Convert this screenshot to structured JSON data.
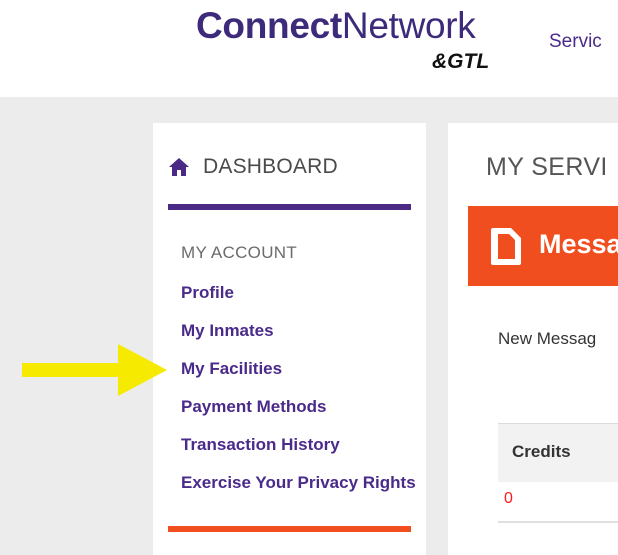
{
  "header": {
    "logo": {
      "primary": "Connect",
      "secondary": "Network",
      "sub": "&GTL"
    },
    "nav": [
      {
        "label": "Servic"
      }
    ]
  },
  "sidebar": {
    "dashboard_label": "DASHBOARD",
    "section_heading": "MY ACCOUNT",
    "items": [
      {
        "label": "Profile"
      },
      {
        "label": "My Inmates"
      },
      {
        "label": "My Facilities"
      },
      {
        "label": "Payment Methods"
      },
      {
        "label": "Transaction History"
      },
      {
        "label": "Exercise Your Privacy Rights"
      }
    ]
  },
  "main": {
    "title": "MY SERVI",
    "banner_label": "Messa",
    "new_message_label": "New Messag",
    "table": {
      "header": "Credits",
      "rows": [
        "0"
      ]
    }
  },
  "colors": {
    "brand_purple": "#4b2a85",
    "accent_orange": "#f04e1e",
    "highlight_yellow": "#f5ea00",
    "credit_red": "#ff1a1a"
  },
  "icons": {
    "dashboard": "home-icon",
    "banner": "document-icon",
    "annotation": "arrow-right-icon"
  }
}
